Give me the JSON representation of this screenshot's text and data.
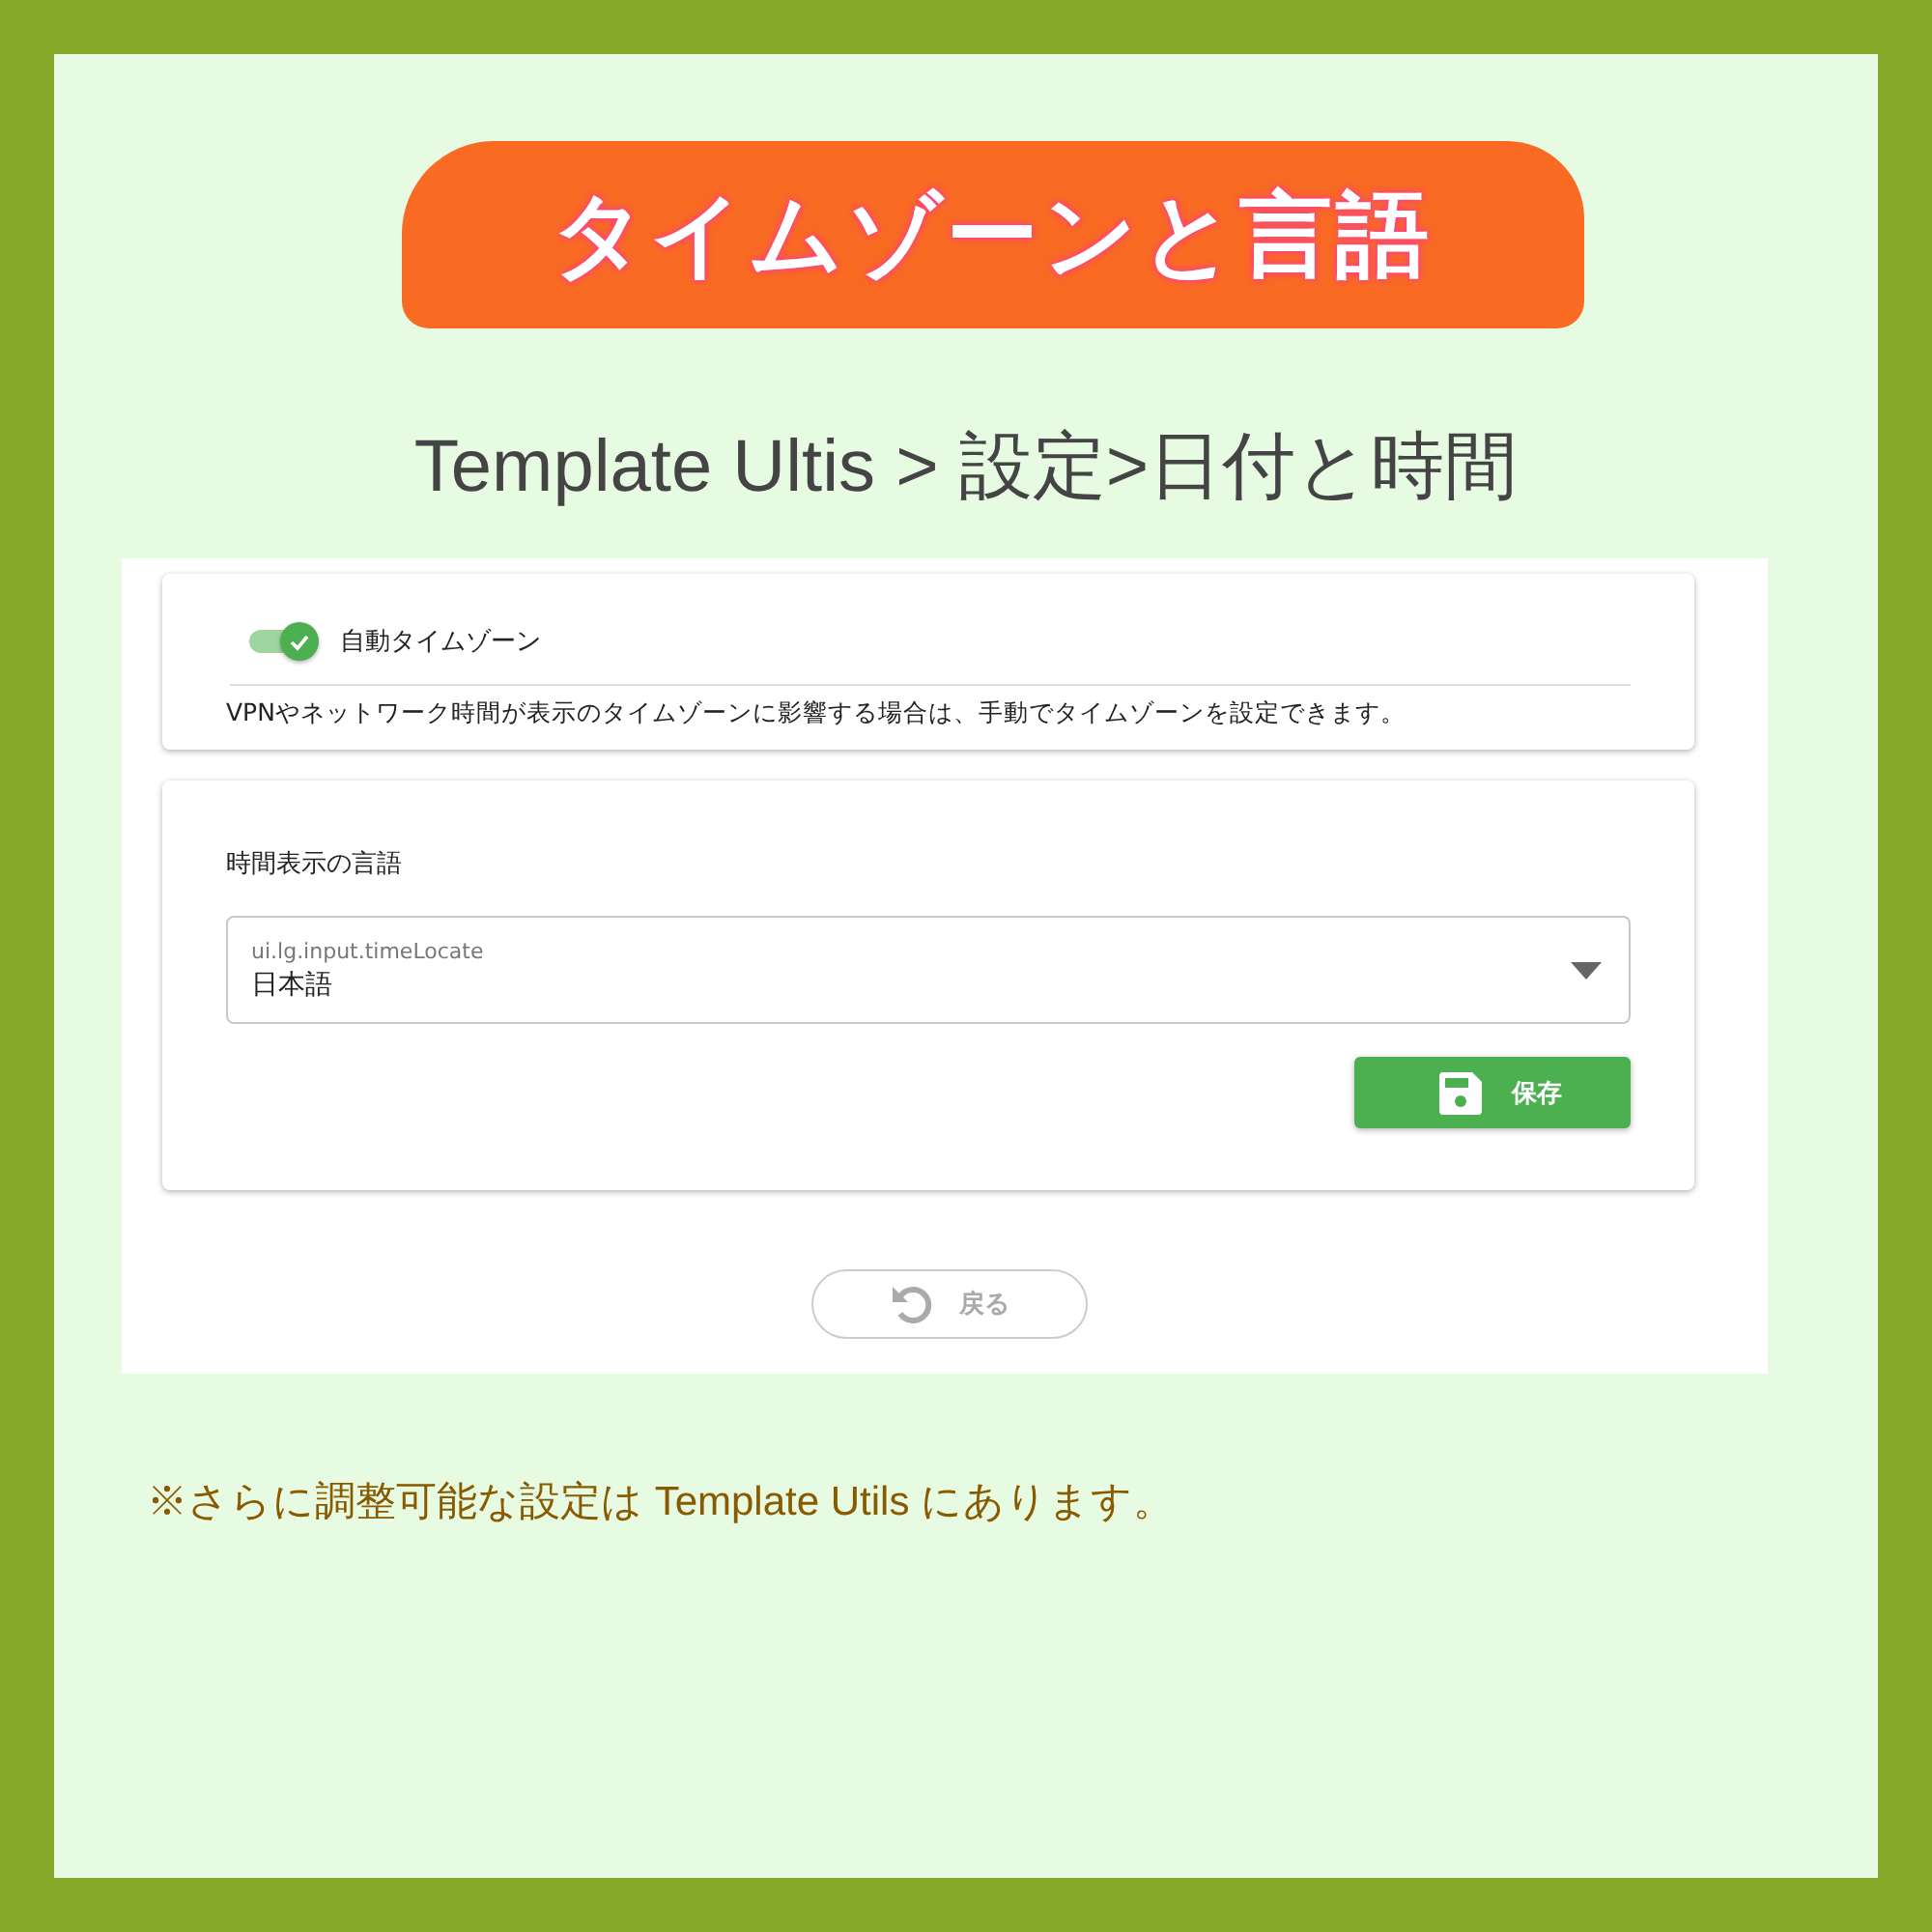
{
  "title": "タイムゾーンと言語",
  "breadcrumb": "Template Ultis > 設定>日付と時間",
  "timezone_card": {
    "toggle": {
      "label": "自動タイムゾーン",
      "on": true
    },
    "description": "VPNやネットワーク時間が表示のタイムゾーンに影響する場合は、手動でタイムゾーンを設定できます。"
  },
  "language_card": {
    "heading": "時間表示の言語",
    "select": {
      "label": "ui.lg.input.timeLocate",
      "value": "日本語"
    },
    "save_button": "保存"
  },
  "back_button": {
    "label": "戻る",
    "disabled": true
  },
  "note": "※さらに調整可能な設定は Template Utils にあります。"
}
